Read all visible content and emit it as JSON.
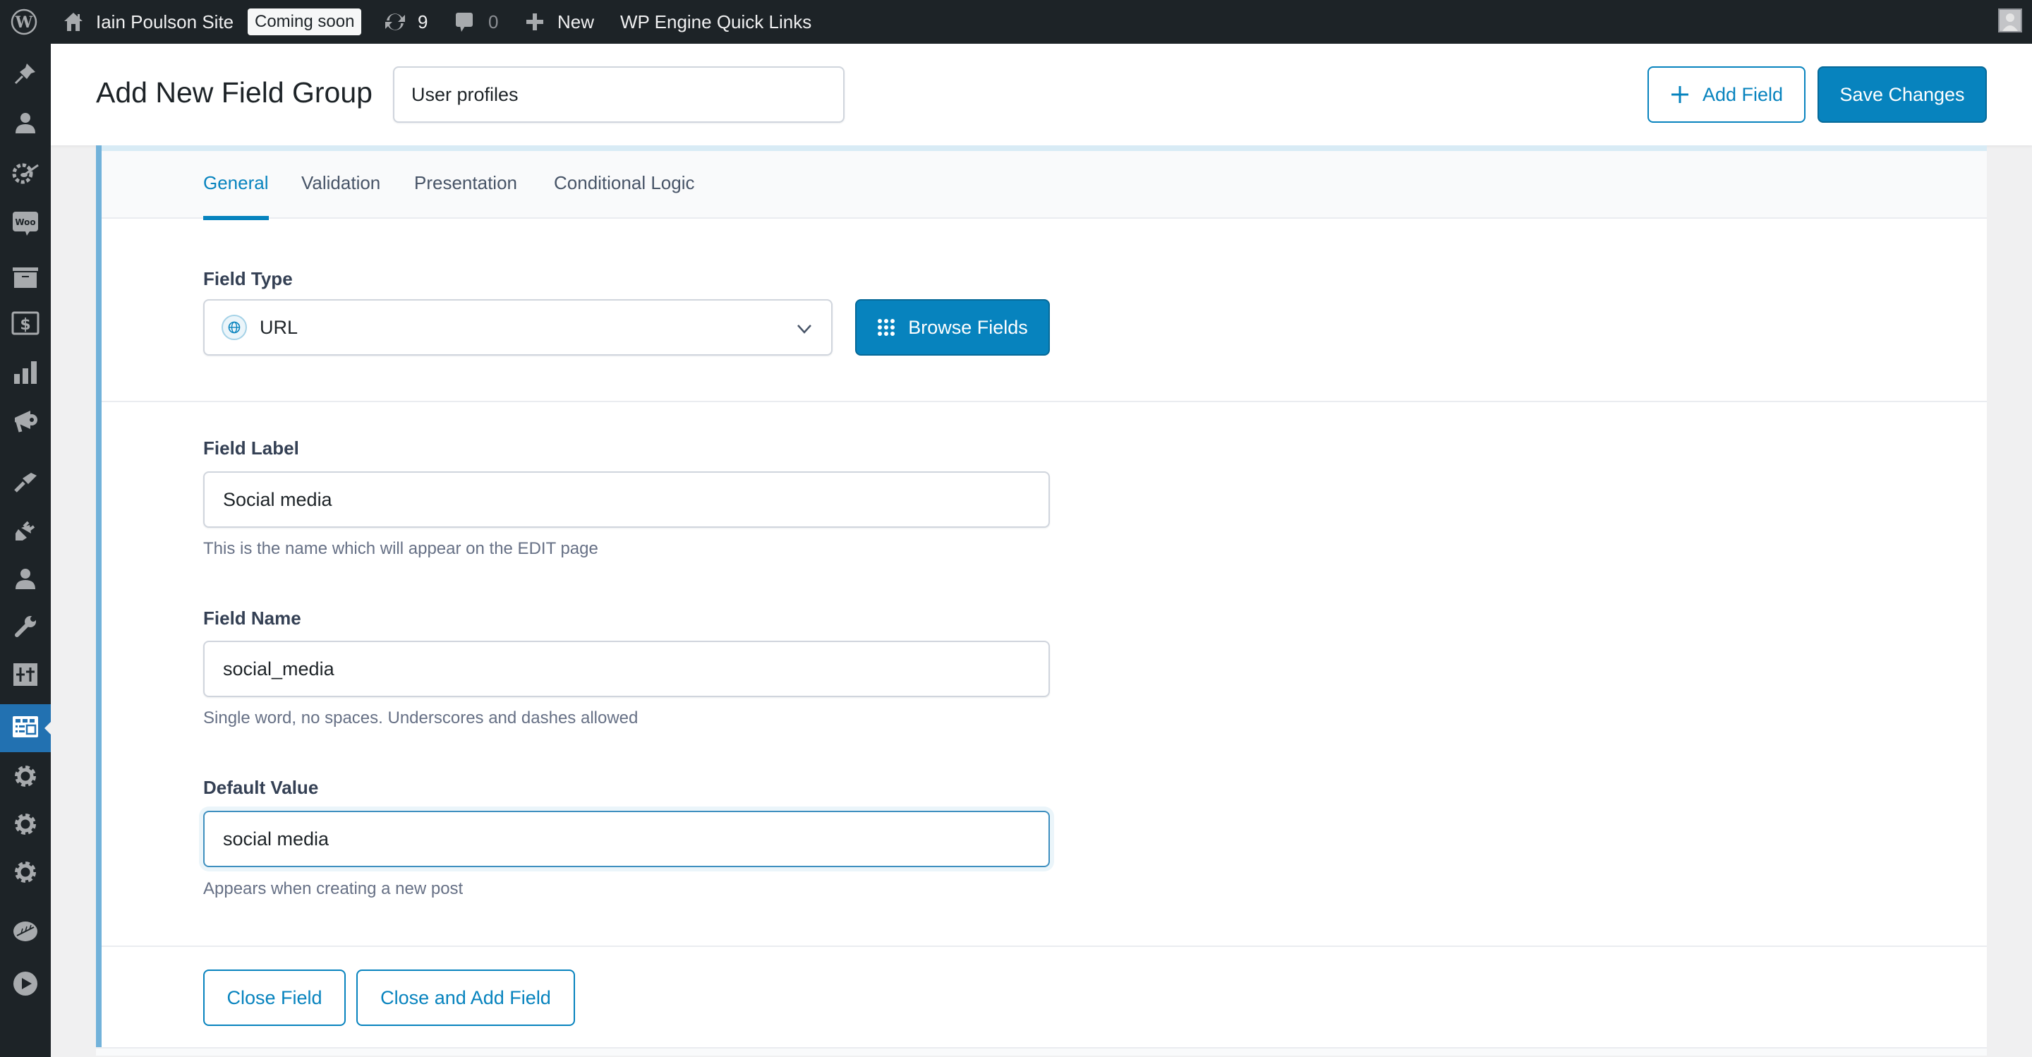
{
  "admin_bar": {
    "site_name": "Iain Poulson Site",
    "status_badge": "Coming soon",
    "updates_count": "9",
    "comments_count": "0",
    "new_label": "New",
    "quick_links_label": "WP Engine Quick Links"
  },
  "sidebar": {
    "items": [
      {
        "icon": "pin-icon"
      },
      {
        "icon": "user-icon"
      },
      {
        "icon": "gear-brush-icon"
      },
      {
        "icon": "woo-icon"
      },
      {
        "icon": "archive-icon"
      },
      {
        "icon": "dollar-icon"
      },
      {
        "icon": "bar-chart-icon"
      },
      {
        "icon": "megaphone-icon"
      },
      {
        "icon": "brush-icon"
      },
      {
        "icon": "plug-icon"
      },
      {
        "icon": "users-icon"
      },
      {
        "icon": "wrench-icon"
      },
      {
        "icon": "sliders-icon"
      },
      {
        "icon": "acf-fields-icon",
        "active": true
      },
      {
        "icon": "gear-icon"
      },
      {
        "icon": "gear-icon"
      },
      {
        "icon": "gear-icon"
      },
      {
        "icon": "leaf-icon"
      },
      {
        "icon": "play-icon"
      }
    ]
  },
  "header": {
    "title": "Add New Field Group",
    "group_title_value": "User profiles",
    "add_field_label": "Add Field",
    "save_label": "Save Changes"
  },
  "field": {
    "tabs": [
      {
        "label": "General",
        "active": true
      },
      {
        "label": "Validation",
        "active": false
      },
      {
        "label": "Presentation",
        "active": false
      },
      {
        "label": "Conditional Logic",
        "active": false
      }
    ],
    "field_type": {
      "label": "Field Type",
      "value": "URL",
      "browse_label": "Browse Fields"
    },
    "field_label": {
      "label": "Field Label",
      "value": "Social media",
      "help": "This is the name which will appear on the EDIT page"
    },
    "field_name": {
      "label": "Field Name",
      "value": "social_media",
      "help": "Single word, no spaces. Underscores and dashes allowed"
    },
    "default_value": {
      "label": "Default Value",
      "value": "social media",
      "help": "Appears when creating a new post"
    },
    "close_label": "Close Field",
    "close_add_label": "Close and Add Field"
  },
  "colors": {
    "accent": "#0783be",
    "admin_bar": "#1d2327",
    "sidebar_active": "#2271b1",
    "panel_border": "#72b2da"
  }
}
